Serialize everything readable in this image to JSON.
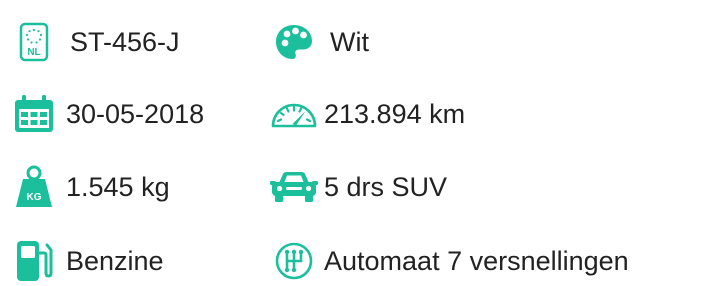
{
  "colors": {
    "accent": "#1bbf9c",
    "text": "#222222"
  },
  "specs": {
    "plate": {
      "icon": "nl-license-plate-icon",
      "label": "ST-456-J"
    },
    "color": {
      "icon": "palette-icon",
      "label": "Wit"
    },
    "date": {
      "icon": "calendar-icon",
      "label": "30-05-2018"
    },
    "mileage": {
      "icon": "speedometer-icon",
      "label": "213.894 km"
    },
    "weight": {
      "icon": "weight-icon",
      "label": "1.545 kg"
    },
    "body": {
      "icon": "car-icon",
      "label": "5 drs SUV"
    },
    "fuel": {
      "icon": "fuel-pump-icon",
      "label": "Benzine"
    },
    "gear": {
      "icon": "gearbox-icon",
      "label": "Automaat 7 versnellingen"
    }
  },
  "icon_text": {
    "plate_country": "NL",
    "weight_unit": "KG"
  }
}
